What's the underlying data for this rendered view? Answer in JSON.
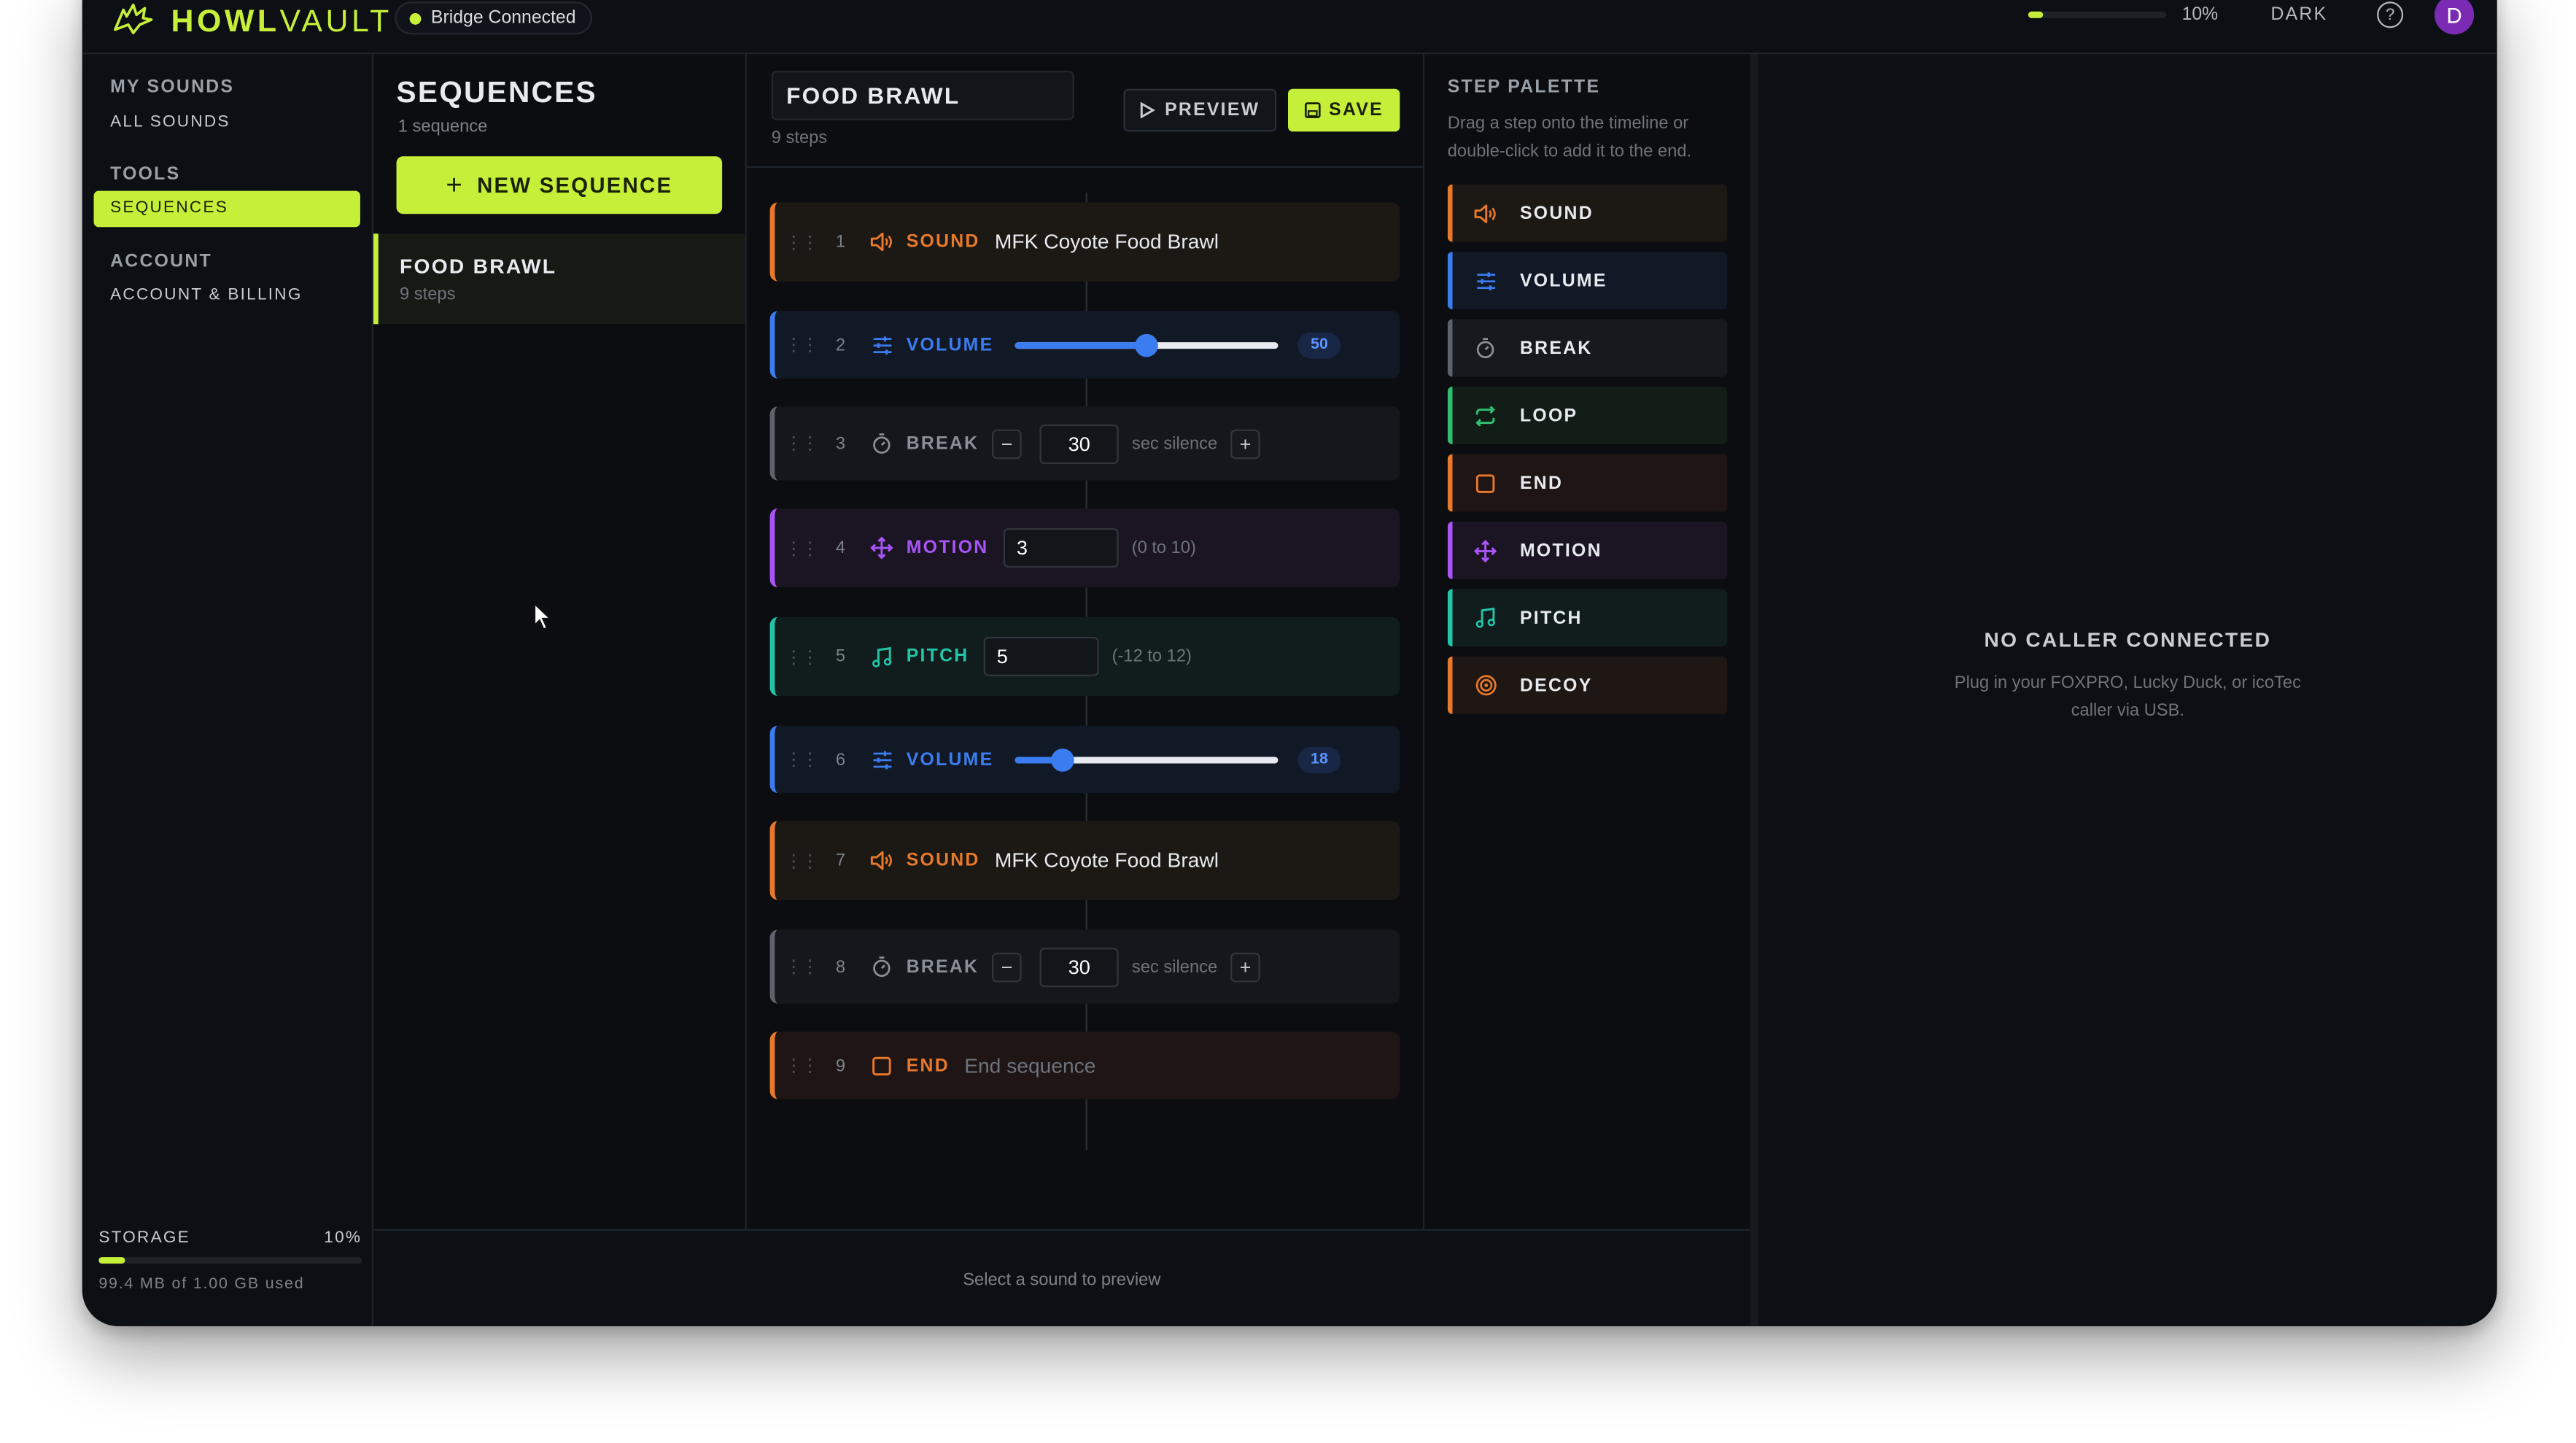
{
  "app": {
    "logo_bold": "HOWL",
    "logo_light": "VAULT",
    "bridge_status": "Bridge Connected"
  },
  "topbar": {
    "storage_pct": "10%",
    "storage_fraction": 0.1,
    "theme_label": "DARK",
    "help_glyph": "?",
    "avatar_initial": "D"
  },
  "sidebar": {
    "my_sounds_heading": "MY SOUNDS",
    "all_sounds": "ALL SOUNDS",
    "tools_heading": "TOOLS",
    "sequences": "SEQUENCES",
    "account_heading": "ACCOUNT",
    "account_billing": "ACCOUNT & BILLING",
    "storage": {
      "label": "STORAGE",
      "pct": "10%",
      "fraction": 0.1,
      "used": "99.4 MB of 1.00 GB used"
    }
  },
  "sequences": {
    "title": "SEQUENCES",
    "count": "1 sequence",
    "new_button": "NEW SEQUENCE",
    "items": [
      {
        "name": "FOOD BRAWL",
        "steps": "9 steps"
      }
    ]
  },
  "editor": {
    "name": "FOOD BRAWL",
    "steps_count": "9 steps",
    "preview_button": "PREVIEW",
    "save_button": "SAVE",
    "steps": [
      {
        "n": "1",
        "type": "SOUND",
        "value": "MFK Coyote Food Brawl"
      },
      {
        "n": "2",
        "type": "VOLUME",
        "value": "50",
        "fraction": 0.5
      },
      {
        "n": "3",
        "type": "BREAK",
        "value": "30",
        "unit": "sec silence",
        "minus": "−",
        "plus": "+"
      },
      {
        "n": "4",
        "type": "MOTION",
        "value": "3",
        "range": "(0 to 10)"
      },
      {
        "n": "5",
        "type": "PITCH",
        "value": "5",
        "range": "(-12 to 12)"
      },
      {
        "n": "6",
        "type": "VOLUME",
        "value": "18",
        "fraction": 0.18
      },
      {
        "n": "7",
        "type": "SOUND",
        "value": "MFK Coyote Food Brawl"
      },
      {
        "n": "8",
        "type": "BREAK",
        "value": "30",
        "unit": "sec silence",
        "minus": "−",
        "plus": "+"
      },
      {
        "n": "9",
        "type": "END",
        "value": "End sequence"
      }
    ]
  },
  "palette": {
    "title": "STEP PALETTE",
    "description": "Drag a step onto the timeline or double-click to add it to the end.",
    "items": [
      {
        "label": "SOUND",
        "icon": "speaker-icon",
        "color": "#e8792b"
      },
      {
        "label": "VOLUME",
        "icon": "sliders-icon",
        "color": "#3b7cf0"
      },
      {
        "label": "BREAK",
        "icon": "stopwatch-icon",
        "color": "#6d737b"
      },
      {
        "label": "LOOP",
        "icon": "loop-icon",
        "color": "#2fbf71"
      },
      {
        "label": "END",
        "icon": "stop-square-icon",
        "color": "#e8792b"
      },
      {
        "label": "MOTION",
        "icon": "move-arrows-icon",
        "color": "#a855f7"
      },
      {
        "label": "PITCH",
        "icon": "music-note-icon",
        "color": "#22c5a8"
      },
      {
        "label": "DECOY",
        "icon": "target-icon",
        "color": "#e8792b"
      }
    ]
  },
  "caller": {
    "title": "NO CALLER CONNECTED",
    "description": "Plug in your FOXPRO, Lucky Duck, or icoTec caller via USB."
  },
  "footer": {
    "preview_hint": "Select a sound to preview"
  },
  "colors": {
    "accent": "#c6ef3a",
    "sound": "#e8792b",
    "volume": "#3b7cf0",
    "break": "#6d737b",
    "motion": "#a855f7",
    "pitch": "#22c5a8",
    "end": "#e8792b",
    "loop": "#2fbf71",
    "avatar": "#7b2bb3"
  }
}
